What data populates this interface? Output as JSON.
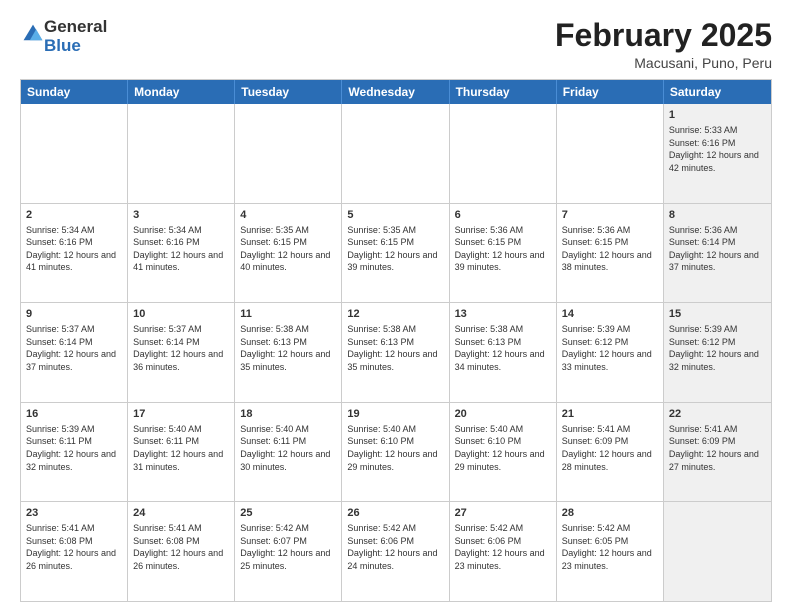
{
  "header": {
    "logo_general": "General",
    "logo_blue": "Blue",
    "month_title": "February 2025",
    "subtitle": "Macusani, Puno, Peru"
  },
  "days_of_week": [
    "Sunday",
    "Monday",
    "Tuesday",
    "Wednesday",
    "Thursday",
    "Friday",
    "Saturday"
  ],
  "weeks": [
    [
      {
        "day": "",
        "info": "",
        "shaded": false
      },
      {
        "day": "",
        "info": "",
        "shaded": false
      },
      {
        "day": "",
        "info": "",
        "shaded": false
      },
      {
        "day": "",
        "info": "",
        "shaded": false
      },
      {
        "day": "",
        "info": "",
        "shaded": false
      },
      {
        "day": "",
        "info": "",
        "shaded": false
      },
      {
        "day": "1",
        "info": "Sunrise: 5:33 AM\nSunset: 6:16 PM\nDaylight: 12 hours and 42 minutes.",
        "shaded": true
      }
    ],
    [
      {
        "day": "2",
        "info": "Sunrise: 5:34 AM\nSunset: 6:16 PM\nDaylight: 12 hours and 41 minutes.",
        "shaded": false
      },
      {
        "day": "3",
        "info": "Sunrise: 5:34 AM\nSunset: 6:16 PM\nDaylight: 12 hours and 41 minutes.",
        "shaded": false
      },
      {
        "day": "4",
        "info": "Sunrise: 5:35 AM\nSunset: 6:15 PM\nDaylight: 12 hours and 40 minutes.",
        "shaded": false
      },
      {
        "day": "5",
        "info": "Sunrise: 5:35 AM\nSunset: 6:15 PM\nDaylight: 12 hours and 39 minutes.",
        "shaded": false
      },
      {
        "day": "6",
        "info": "Sunrise: 5:36 AM\nSunset: 6:15 PM\nDaylight: 12 hours and 39 minutes.",
        "shaded": false
      },
      {
        "day": "7",
        "info": "Sunrise: 5:36 AM\nSunset: 6:15 PM\nDaylight: 12 hours and 38 minutes.",
        "shaded": false
      },
      {
        "day": "8",
        "info": "Sunrise: 5:36 AM\nSunset: 6:14 PM\nDaylight: 12 hours and 37 minutes.",
        "shaded": true
      }
    ],
    [
      {
        "day": "9",
        "info": "Sunrise: 5:37 AM\nSunset: 6:14 PM\nDaylight: 12 hours and 37 minutes.",
        "shaded": false
      },
      {
        "day": "10",
        "info": "Sunrise: 5:37 AM\nSunset: 6:14 PM\nDaylight: 12 hours and 36 minutes.",
        "shaded": false
      },
      {
        "day": "11",
        "info": "Sunrise: 5:38 AM\nSunset: 6:13 PM\nDaylight: 12 hours and 35 minutes.",
        "shaded": false
      },
      {
        "day": "12",
        "info": "Sunrise: 5:38 AM\nSunset: 6:13 PM\nDaylight: 12 hours and 35 minutes.",
        "shaded": false
      },
      {
        "day": "13",
        "info": "Sunrise: 5:38 AM\nSunset: 6:13 PM\nDaylight: 12 hours and 34 minutes.",
        "shaded": false
      },
      {
        "day": "14",
        "info": "Sunrise: 5:39 AM\nSunset: 6:12 PM\nDaylight: 12 hours and 33 minutes.",
        "shaded": false
      },
      {
        "day": "15",
        "info": "Sunrise: 5:39 AM\nSunset: 6:12 PM\nDaylight: 12 hours and 32 minutes.",
        "shaded": true
      }
    ],
    [
      {
        "day": "16",
        "info": "Sunrise: 5:39 AM\nSunset: 6:11 PM\nDaylight: 12 hours and 32 minutes.",
        "shaded": false
      },
      {
        "day": "17",
        "info": "Sunrise: 5:40 AM\nSunset: 6:11 PM\nDaylight: 12 hours and 31 minutes.",
        "shaded": false
      },
      {
        "day": "18",
        "info": "Sunrise: 5:40 AM\nSunset: 6:11 PM\nDaylight: 12 hours and 30 minutes.",
        "shaded": false
      },
      {
        "day": "19",
        "info": "Sunrise: 5:40 AM\nSunset: 6:10 PM\nDaylight: 12 hours and 29 minutes.",
        "shaded": false
      },
      {
        "day": "20",
        "info": "Sunrise: 5:40 AM\nSunset: 6:10 PM\nDaylight: 12 hours and 29 minutes.",
        "shaded": false
      },
      {
        "day": "21",
        "info": "Sunrise: 5:41 AM\nSunset: 6:09 PM\nDaylight: 12 hours and 28 minutes.",
        "shaded": false
      },
      {
        "day": "22",
        "info": "Sunrise: 5:41 AM\nSunset: 6:09 PM\nDaylight: 12 hours and 27 minutes.",
        "shaded": true
      }
    ],
    [
      {
        "day": "23",
        "info": "Sunrise: 5:41 AM\nSunset: 6:08 PM\nDaylight: 12 hours and 26 minutes.",
        "shaded": false
      },
      {
        "day": "24",
        "info": "Sunrise: 5:41 AM\nSunset: 6:08 PM\nDaylight: 12 hours and 26 minutes.",
        "shaded": false
      },
      {
        "day": "25",
        "info": "Sunrise: 5:42 AM\nSunset: 6:07 PM\nDaylight: 12 hours and 25 minutes.",
        "shaded": false
      },
      {
        "day": "26",
        "info": "Sunrise: 5:42 AM\nSunset: 6:06 PM\nDaylight: 12 hours and 24 minutes.",
        "shaded": false
      },
      {
        "day": "27",
        "info": "Sunrise: 5:42 AM\nSunset: 6:06 PM\nDaylight: 12 hours and 23 minutes.",
        "shaded": false
      },
      {
        "day": "28",
        "info": "Sunrise: 5:42 AM\nSunset: 6:05 PM\nDaylight: 12 hours and 23 minutes.",
        "shaded": false
      },
      {
        "day": "",
        "info": "",
        "shaded": true
      }
    ]
  ]
}
